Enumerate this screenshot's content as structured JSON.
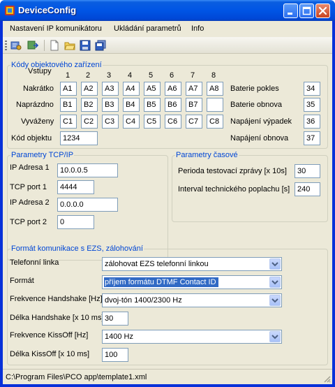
{
  "window": {
    "title": "DeviceConfig"
  },
  "menu": [
    "Nastavení IP komunikátoru",
    "Ukládání parametrů",
    "Info"
  ],
  "toolbar": {
    "icons": [
      "load-config-icon",
      "send-config-icon",
      "new-document-icon",
      "open-folder-icon",
      "save-disk-icon",
      "save-all-icon"
    ]
  },
  "codes": {
    "legend": "Kódy objektového zařízení",
    "inputs_label": "Vstupy",
    "columns": [
      "1",
      "2",
      "3",
      "4",
      "5",
      "6",
      "7",
      "8"
    ],
    "rows": [
      {
        "label": "Nakrátko",
        "values": [
          "A1",
          "A2",
          "A3",
          "A4",
          "A5",
          "A6",
          "A7",
          "A8"
        ]
      },
      {
        "label": "Naprázdno",
        "values": [
          "B1",
          "B2",
          "B3",
          "B4",
          "B5",
          "B6",
          "B7",
          ""
        ]
      },
      {
        "label": "Vyváženy",
        "values": [
          "C1",
          "C2",
          "C3",
          "C4",
          "C5",
          "C6",
          "C7",
          "C8"
        ]
      }
    ],
    "object_code_label": "Kód objektu",
    "object_code": "1234",
    "battery": [
      {
        "label": "Baterie pokles",
        "value": "34"
      },
      {
        "label": "Baterie obnova",
        "value": "35"
      },
      {
        "label": "Napájení výpadek",
        "value": "36"
      },
      {
        "label": "Napájení obnova",
        "value": "37"
      }
    ]
  },
  "tcp": {
    "legend": "Parametry TCP/IP",
    "ip1_label": "IP Adresa 1",
    "ip1": "10.0.0.5",
    "port1_label": "TCP port 1",
    "port1": "4444",
    "ip2_label": "IP Adresa 2",
    "ip2": "0.0.0.0",
    "port2_label": "TCP port 2",
    "port2": "0"
  },
  "timing": {
    "legend": "Parametry časové",
    "test_label": "Perioda testovací zprávy [x 10s]",
    "test": "30",
    "interval_label": "Interval technického poplachu [s]",
    "interval": "240"
  },
  "format": {
    "legend": "Formát komunikace s EZS, zálohování",
    "phone_label": "Telefonní linka",
    "phone": "zálohovat EZS telefonní linkou",
    "format_label": "Formát",
    "format": "příjem formátu DTMF Contact ID",
    "hs_freq_label": "Frekvence Handshake [Hz]",
    "hs_freq": "dvoj-tón 1400/2300 Hz",
    "hs_len_label": "Délka Handshake [x 10 ms]",
    "hs_len": "30",
    "ko_freq_label": "Frekvence KissOff [Hz]",
    "ko_freq": "1400 Hz",
    "ko_len_label": "Délka KissOff [x 10 ms]",
    "ko_len": "100"
  },
  "status": {
    "path": "C:\\Program Files\\PCO app\\template1.xml"
  },
  "colors": {
    "title_bar": "#0055e5",
    "group_legend": "#0046d5",
    "selection": "#316ac5"
  }
}
